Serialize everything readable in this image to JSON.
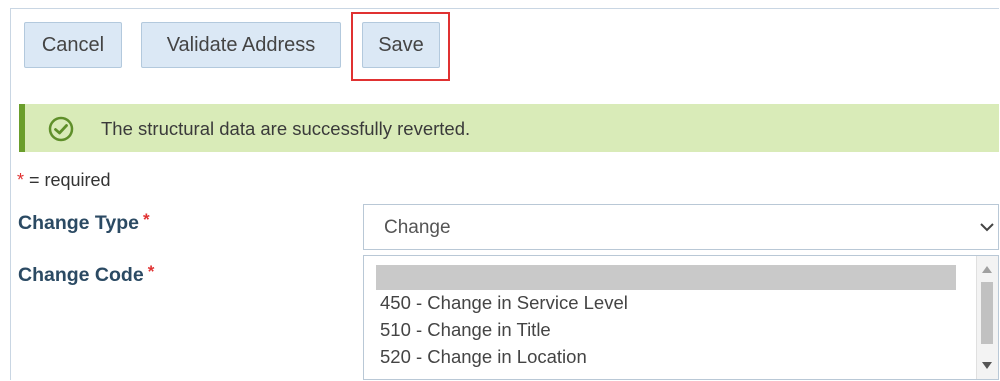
{
  "toolbar": {
    "cancel_label": "Cancel",
    "validate_label": "Validate Address",
    "save_label": "Save"
  },
  "alert": {
    "message": "The structural data are successfully reverted.",
    "icon": "check-circle-icon"
  },
  "form": {
    "required_note_star": "*",
    "required_note_text": " = required",
    "change_type": {
      "label": "Change Type",
      "required": "*",
      "value": "Change"
    },
    "change_code": {
      "label": "Change Code",
      "required": "*",
      "options": [
        "",
        "450 - Change in Service Level",
        "510 - Change in Title",
        "520 - Change in Location"
      ]
    }
  },
  "colors": {
    "button_bg": "#dbe8f5",
    "highlight": "#e03131",
    "alert_bg": "#d9ebb8",
    "alert_accent": "#6a9e2b",
    "label": "#2b4a63"
  }
}
